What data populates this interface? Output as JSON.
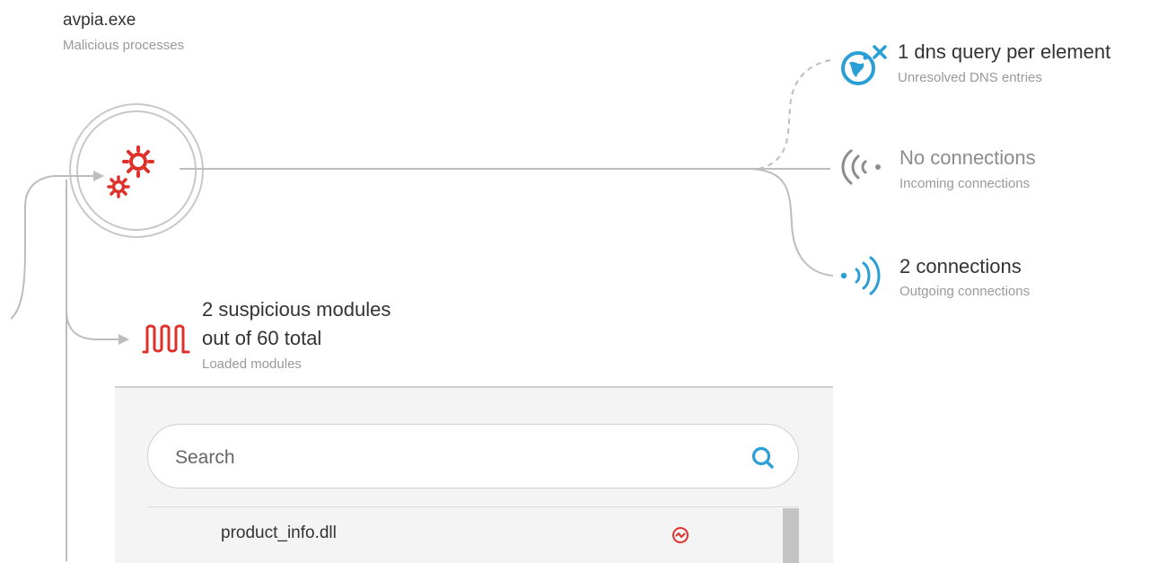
{
  "process": {
    "name": "avpia.exe",
    "category": "Malicious processes"
  },
  "dns": {
    "value": "1 dns query per element",
    "label": "Unresolved DNS entries",
    "icon": "globe-x-icon",
    "color": "#2a9fd6"
  },
  "incoming": {
    "value": "No connections",
    "label": "Incoming connections",
    "icon": "incoming-signal-icon",
    "color": "#8c8c8c"
  },
  "outgoing": {
    "value": "2 connections",
    "label": "Outgoing connections",
    "icon": "outgoing-signal-icon",
    "color": "#2a9fd6"
  },
  "modules": {
    "value_line1": "2 suspicious modules",
    "value_line2": "out of 60 total",
    "label": "Loaded modules",
    "icon": "modules-wave-icon",
    "color": "#e0302a"
  },
  "search": {
    "placeholder": "Search"
  },
  "module_list": [
    {
      "name": "product_info.dll",
      "status_icon": "suspicious-badge-icon"
    }
  ],
  "colors": {
    "alert": "#e0302a",
    "accent": "#2a9fd6",
    "line": "#bdbdbd",
    "panel": "#f4f4f4"
  }
}
